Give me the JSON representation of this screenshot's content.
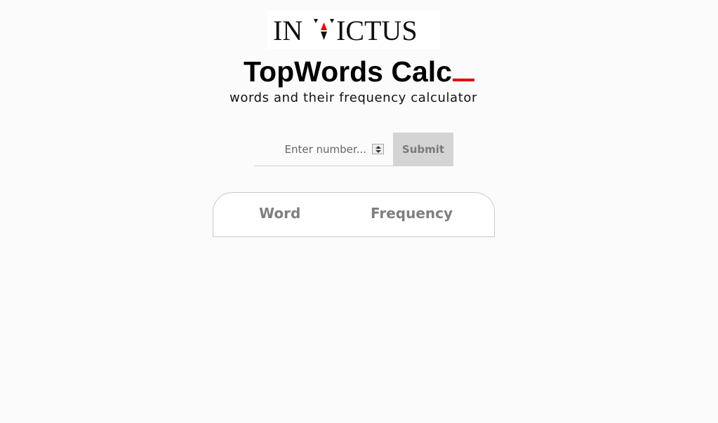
{
  "logo": {
    "text": "INVICTUS",
    "accent_color": "#e60000"
  },
  "header": {
    "title": "TopWords Calc",
    "title_cursor": "_",
    "cursor_color": "#e60000",
    "subtitle": "words and their frequency calculator"
  },
  "form": {
    "number_placeholder": "Enter number...",
    "number_value": "",
    "submit_label": "Submit"
  },
  "table": {
    "columns": [
      "Word",
      "Frequency"
    ],
    "rows": []
  },
  "icons": {
    "spinner": "spinner-arrows-icon"
  }
}
